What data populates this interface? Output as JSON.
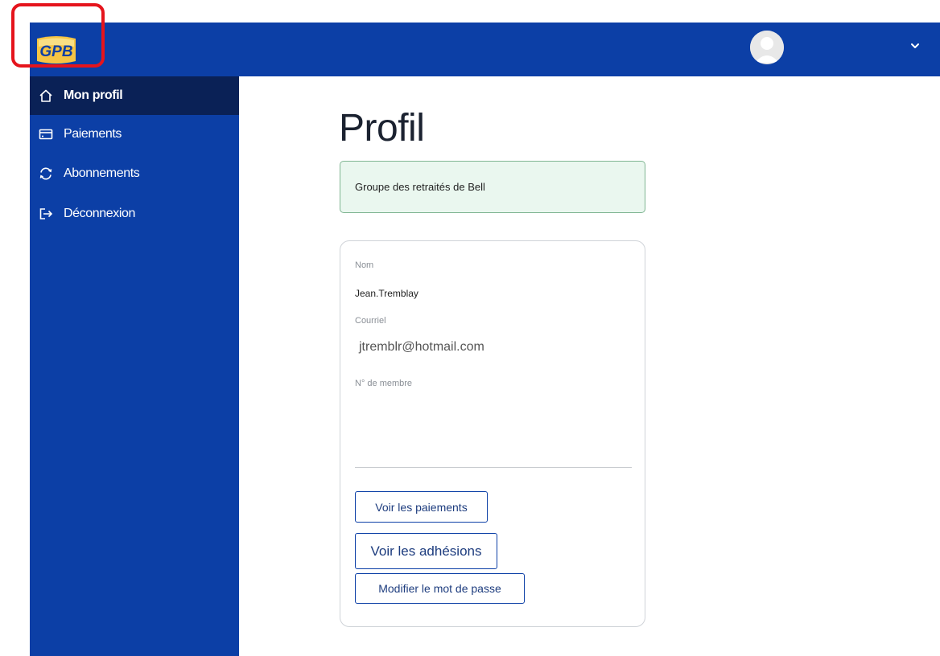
{
  "header": {
    "logo_text": "GPB"
  },
  "sidebar": {
    "items": [
      {
        "label": "Mon profil",
        "icon": "home-icon",
        "active": true
      },
      {
        "label": "Paiements",
        "icon": "credit-card-icon",
        "active": false
      },
      {
        "label": "Abonnements",
        "icon": "refresh-icon",
        "active": false
      },
      {
        "label": "Déconnexion",
        "icon": "logout-icon",
        "active": false
      }
    ]
  },
  "main": {
    "title": "Profil",
    "group_name": "Groupe des retraités de Bell",
    "profile": {
      "name_label": "Nom",
      "name_value": "Jean.Tremblay",
      "email_label": "Courriel",
      "email_value": "jtremblr@hotmail.com",
      "member_label": "N° de membre",
      "member_value": ""
    },
    "buttons": {
      "view_payments": "Voir les paiements",
      "view_memberships": "Voir les adhésions",
      "change_password": "Modifier le mot de passe"
    }
  },
  "colors": {
    "brand_blue": "#0c3fa6",
    "active_nav": "#0a2156",
    "highlight_red": "#e5141c",
    "banner_bg": "#eaf7ef",
    "banner_border": "#7fb592"
  }
}
